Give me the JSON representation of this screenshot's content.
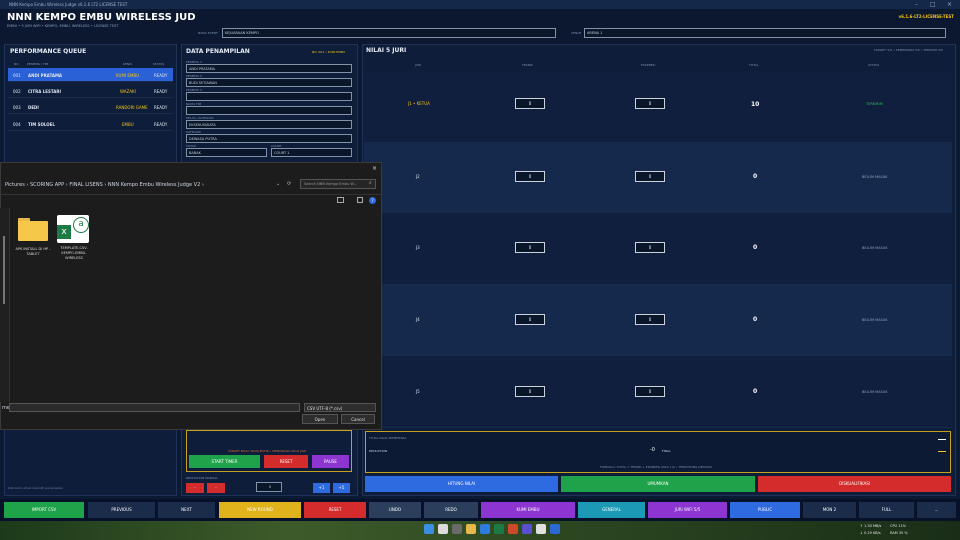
{
  "window": {
    "title": "NNN Kempo Embu Wireless Judge v6.1.6 LT2 LICENSE TEST"
  },
  "header": {
    "title": "NNN KEMPO EMBU WIRELESS JUD",
    "subtitle": "EMBU • 5 JURI WIFI • KEMPO, EMBU, WIRELESS • LICENSE TEST",
    "event_label": "NAMA EVENT",
    "event_value": "KEJUARAAN KEMPO",
    "venue_label": "VENUE",
    "venue_value": "ARENA 1",
    "license": "v6.1.6-LT2-LICENSE-TEST"
  },
  "queue": {
    "title": "PERFORMANCE QUEUE",
    "columns": [
      "NO",
      "PESERTA / TIM",
      "KENIS",
      "STATUS"
    ],
    "rows": [
      {
        "no": "001",
        "name": "ANDI PRATAMA",
        "kenis": "KUMI EMBU",
        "status": "READY"
      },
      {
        "no": "002",
        "name": "CITRA LESTARI",
        "kenis": "WAZAKI",
        "status": "READY"
      },
      {
        "no": "003",
        "name": "DEDI",
        "kenis": "RANDORI GAME",
        "status": "READY"
      },
      {
        "no": "004",
        "name": "TIM SOLOEL",
        "kenis": "EMBU",
        "status": "READY"
      }
    ],
    "footer": "Klik baris untuk memilih penampilan"
  },
  "data": {
    "title": "DATA PENAMPILAN",
    "meta": "NO. 001 • KUMI EMBU",
    "fields": [
      {
        "label": "PESERTA 1",
        "value": "ANDI PRATAMA"
      },
      {
        "label": "PESERTA 2",
        "value": "BUDI SETIAWAN"
      },
      {
        "label": "PESERTA 3",
        "value": ""
      },
      {
        "label": "NAMA TIM",
        "value": ""
      },
      {
        "label": "KELAS / KATEGORI",
        "value": "EKSEKUSI/KATA"
      },
      {
        "label": "KATEGORI",
        "value": "DEWASA PUTRA"
      }
    ],
    "ronde_label": "TAHAP",
    "ronde_value": "BABAK",
    "court_label": "COURT",
    "court_value": "COURT 1",
    "status_line": "TARGET NILAI: SKOR BUTIR • MENUNGGU NILAI JURI",
    "btn_start": "START TIMER",
    "btn_reset": "RESET",
    "btn_pause": "PAUSE",
    "deduction_label": "DEDUCTION MANUAL",
    "deduction_value": "0",
    "deduction_minus": "-",
    "deduction_plus": "+",
    "deduction_p1": "+1",
    "deduction_p5": "+5"
  },
  "judges": {
    "title": "NILAI 5 JURI",
    "meta": "TARGET: 5/5 • SEMENTARA 5/5 • TERSISIH 0/5",
    "columns": [
      "JURI",
      "TEKNIK",
      "EKSPRESI",
      "TOTAL",
      "STATUS"
    ],
    "rows": [
      {
        "juri": "J1 • KETUA",
        "teknik": "0",
        "ekspresi": "0",
        "total": "10",
        "status": "TERKIRIM"
      },
      {
        "juri": "J2",
        "teknik": "0",
        "ekspresi": "0",
        "total": "0",
        "status": "BELUM MASUK"
      },
      {
        "juri": "J3",
        "teknik": "0",
        "ekspresi": "0",
        "total": "0",
        "status": "BELUM MASUK"
      },
      {
        "juri": "J4",
        "teknik": "0",
        "ekspresi": "0",
        "total": "0",
        "status": "BELUM MASUK"
      },
      {
        "juri": "J5",
        "teknik": "0",
        "ekspresi": "0",
        "total": "0",
        "status": "BELUM MASUK"
      }
    ]
  },
  "score": {
    "label": "TOTAL NILAI SEMENTARA",
    "deduction_label": "DEDUCTION",
    "deduction_value": "-0",
    "final_label": "FINAL",
    "formula": "FORMULA: TOTAL = TEKNIK + EKSPRESI (MAX 10) • TERPOTONG DEDUKSI",
    "btn_hitung": "HITUNG NILAI",
    "btn_umumkan": "UMUMKAN",
    "btn_diskualifikasi": "DISKUALIFIKASI"
  },
  "toolbar": [
    {
      "label": "IMPORT CSV",
      "color": "#1fa34a"
    },
    {
      "label": "PREVIOUS",
      "color": "#1b2c4b"
    },
    {
      "label": "NEXT",
      "color": "#1b2c4b"
    },
    {
      "label": "NEW ROUND",
      "color": "#e0b21c"
    },
    {
      "label": "RESET",
      "color": "#d42c2c"
    },
    {
      "label": "UNDO",
      "color": "#2b3f5c"
    },
    {
      "label": "REDO",
      "color": "#2b3f5c"
    },
    {
      "label": "KUMI EMBU",
      "color": "#8c35d0"
    },
    {
      "label": "GENERAL",
      "color": "#1c9ab5"
    },
    {
      "label": "JURI WIFI 5/5",
      "color": "#8c35d0"
    },
    {
      "label": "PUBLIC",
      "color": "#2e6ae0"
    },
    {
      "label": "MON 2",
      "color": "#1b2c4b"
    },
    {
      "label": "FULL",
      "color": "#1b2c4b"
    },
    {
      "label": "...",
      "color": "#1b2c4b"
    }
  ],
  "dialog": {
    "breadcrumb": "Pictures  ›  SCORING APP  ›  FINAL LISENS  ›  NNN Kempo Embu Wireless Judge V2  ›",
    "search_placeholder": "Search NNN Kempo Embu W...",
    "files": [
      {
        "name": "APK INSTALL DI HP - TABLET",
        "type": "folder"
      },
      {
        "name": "TEMPLATE-CSV-KEMPO-EMBU-WIRELESS",
        "type": "excel"
      }
    ],
    "filename_label": "me:",
    "filetype": "CSV UTF-8 (*.csv)",
    "open_label": "Open",
    "cancel_label": "Cancel"
  },
  "taskbar": {
    "net_up": "↑ 1.30 MB/s",
    "net_down": "↓ 0.29 KB/s",
    "cpu": "CPU 11%",
    "ram": "RAM 35 %"
  }
}
